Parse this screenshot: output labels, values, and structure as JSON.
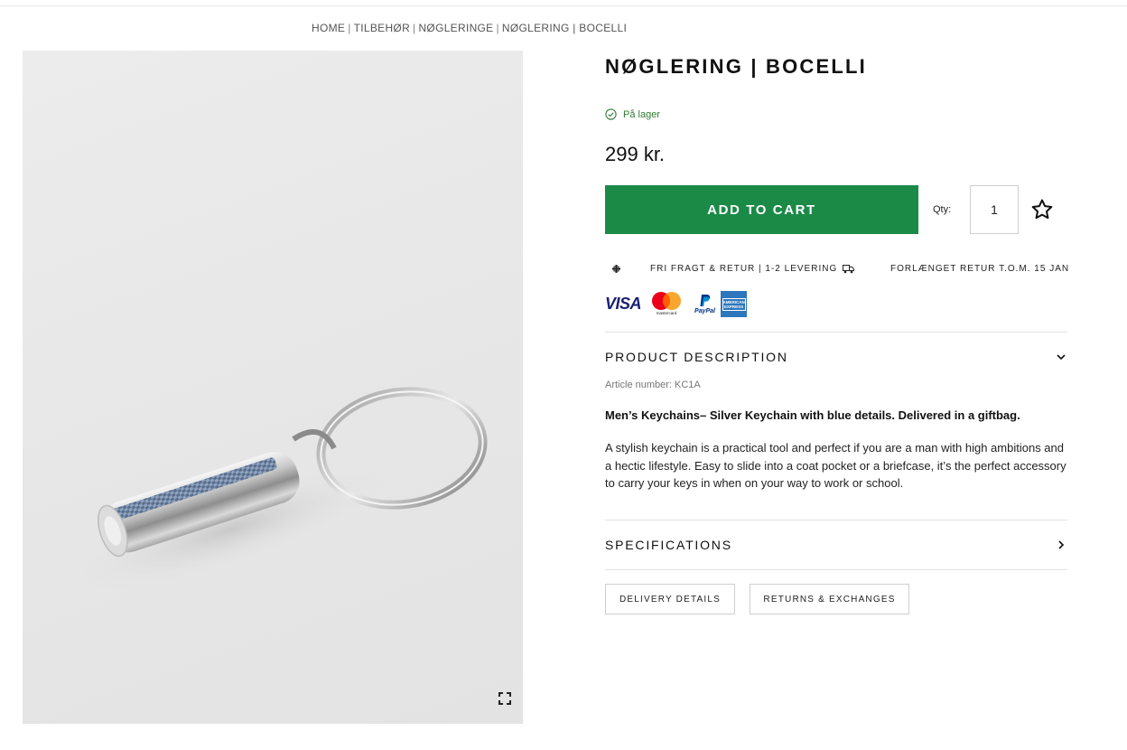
{
  "breadcrumb": {
    "items": [
      "HOME",
      "TILBEHØR",
      "NØGLERINGE",
      "NØGLERING | BOCELLI"
    ],
    "separator": "|"
  },
  "product": {
    "title": "NØGLERING | BOCELLI",
    "stock_status": "På lager",
    "price": "299 kr.",
    "add_to_cart_label": "ADD TO CART",
    "qty_label": "Qty:",
    "qty_value": "1",
    "wishlist_icon": "star-outline-icon"
  },
  "usps": [
    {
      "icon": "plus-icon",
      "text": "FRI FRAGT & RETUR | 1-2 LEVERING"
    },
    {
      "icon": "truck-icon",
      "text": "FORLÆNGET RETUR T.O.M. 15 JAN"
    }
  ],
  "payments": {
    "visa": "VISA",
    "mastercard": "mastercard",
    "paypal": "PayPal",
    "amex": "AMERICAN EXPRESS"
  },
  "description": {
    "heading": "PRODUCT DESCRIPTION",
    "expanded": true,
    "article_number": "Article number: KC1A",
    "lead": "Men’s Keychains– Silver Keychain with blue details. Delivered in a giftbag.",
    "body": "A stylish keychain is a practical tool and perfect if you are a man with high ambitions and a hectic lifestyle. Easy to slide into a coat pocket or a briefcase, it’s the perfect accessory to carry your keys in when on your way to work or school."
  },
  "specifications": {
    "heading": "SPECIFICATIONS",
    "expanded": false
  },
  "info_buttons": {
    "delivery": "DELIVERY DETAILS",
    "returns": "RETURNS & EXCHANGES"
  },
  "colors": {
    "accent_green": "#1b8a47",
    "stock_green": "#2e7d32",
    "visa_blue": "#1a1f71",
    "amex_blue": "#2e77bc"
  }
}
